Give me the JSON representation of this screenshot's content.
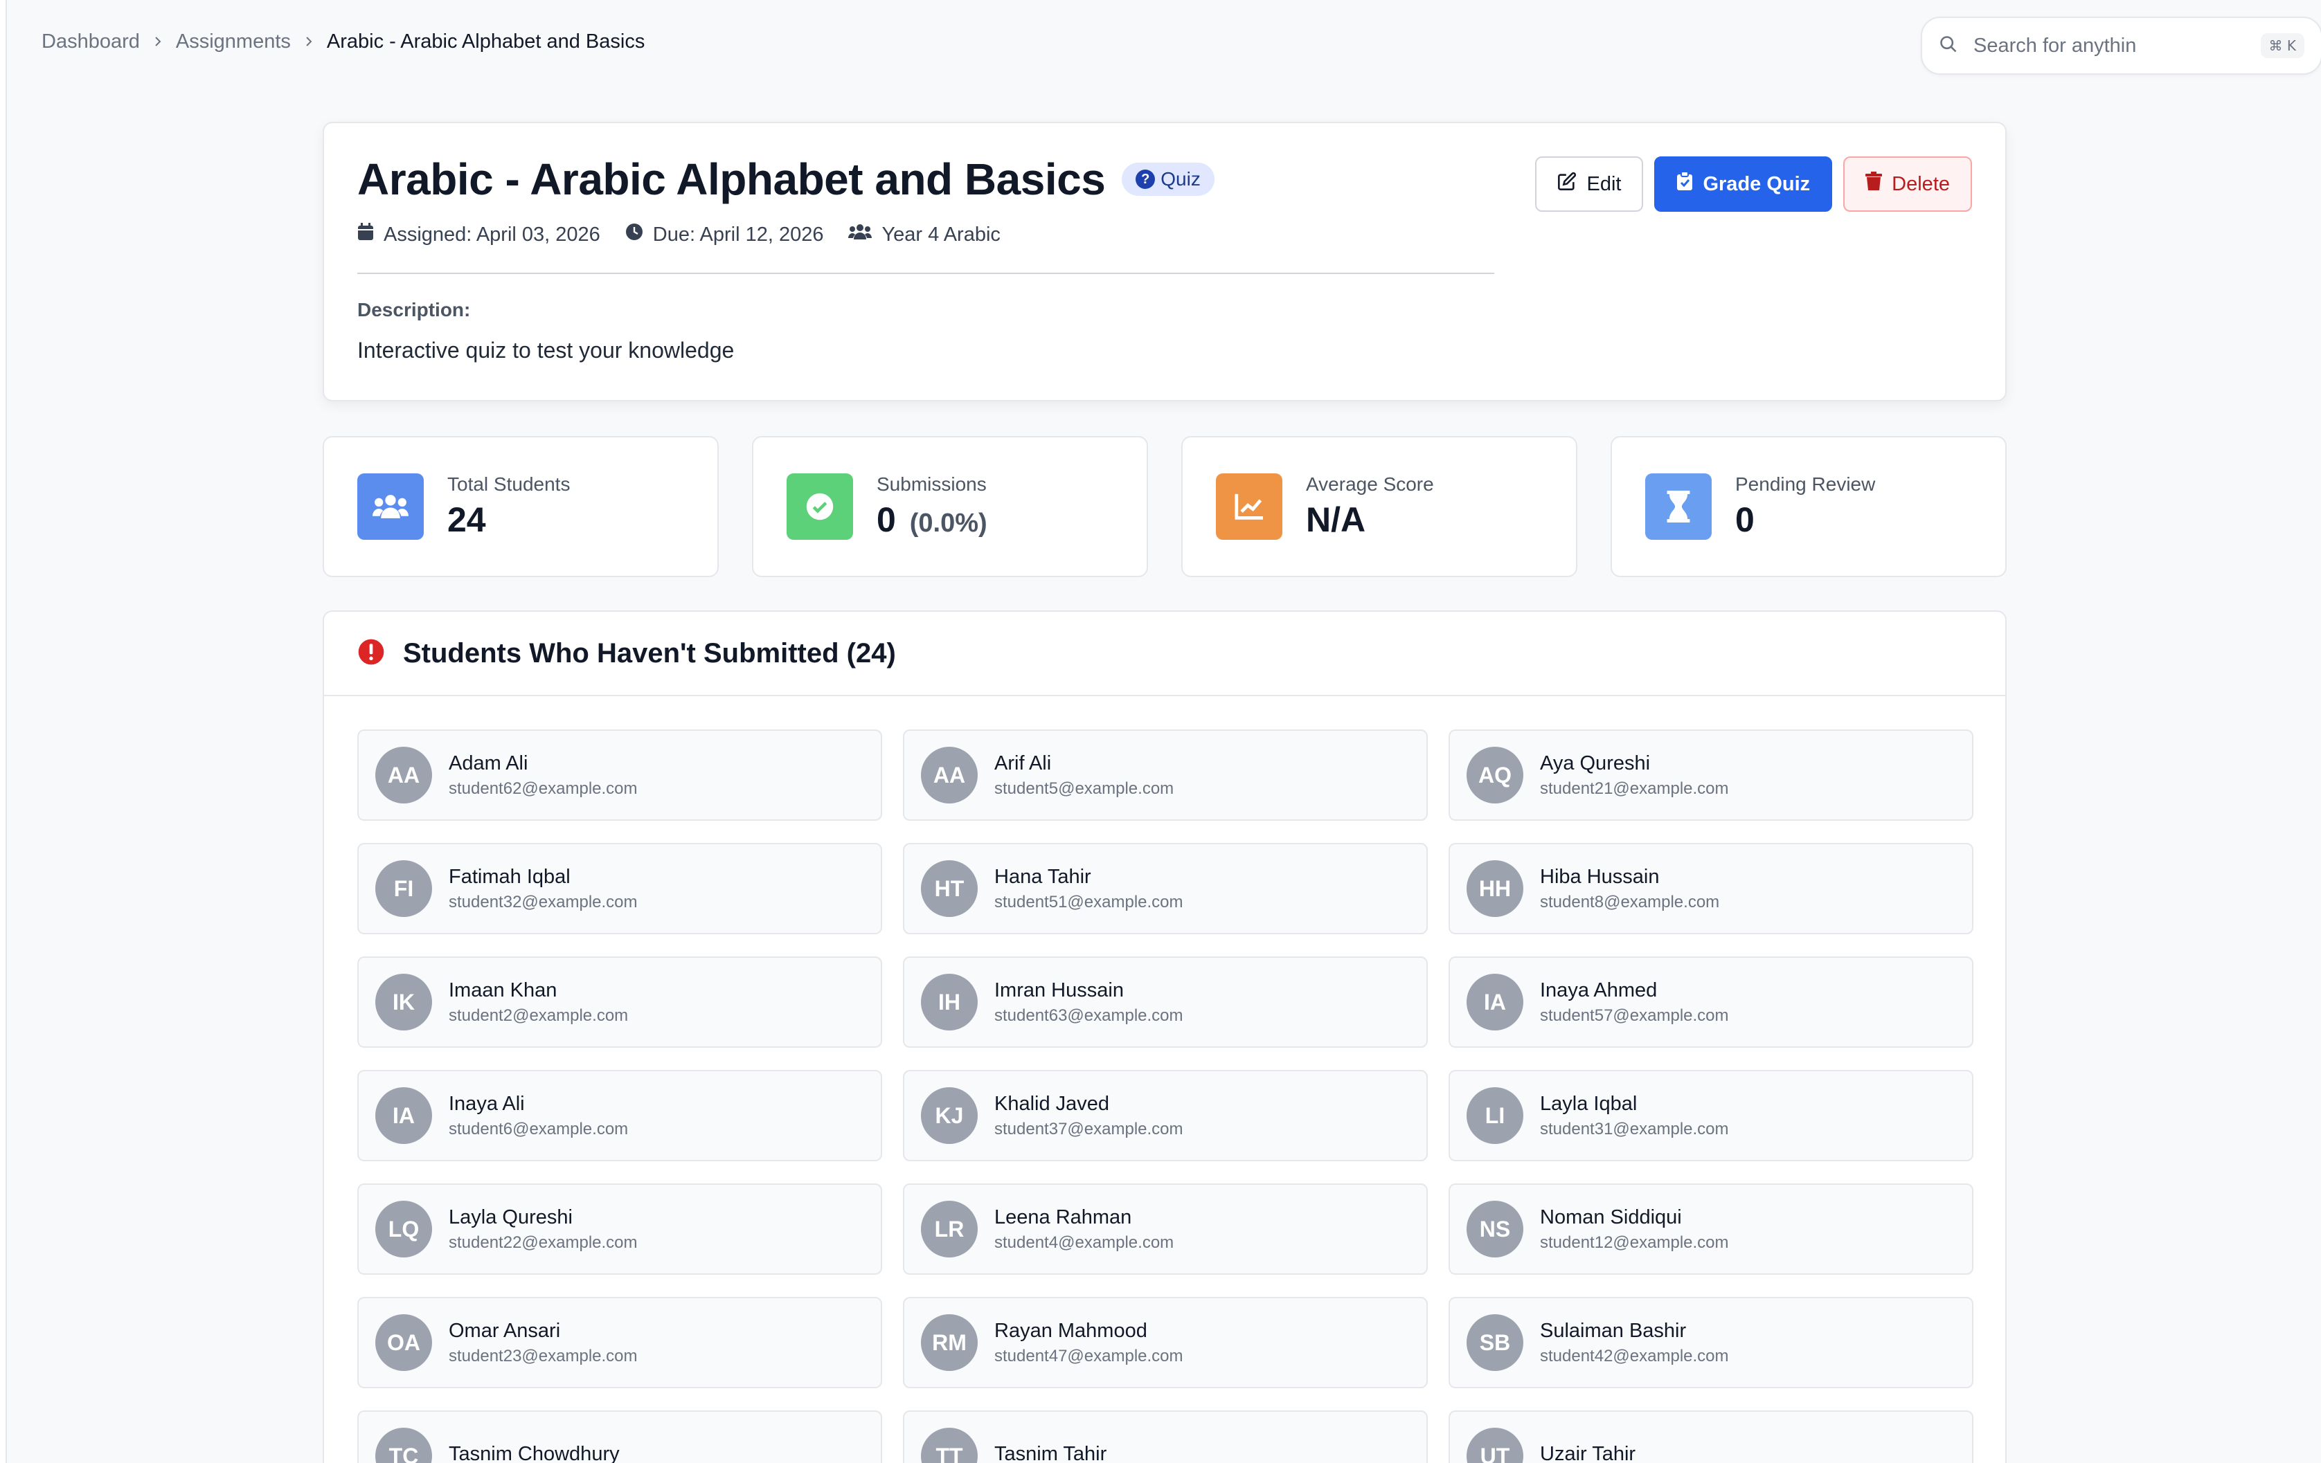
{
  "breadcrumb": {
    "items": [
      "Dashboard",
      "Assignments"
    ],
    "current": "Arabic - Arabic Alphabet and Basics"
  },
  "search": {
    "placeholder": "Search for anythin",
    "shortcut": "⌘ K"
  },
  "assignment": {
    "title": "Arabic - Arabic Alphabet and Basics",
    "type_badge": "Quiz",
    "assigned": "Assigned: April 03, 2026",
    "due": "Due: April 12, 2026",
    "class": "Year 4 Arabic",
    "description_label": "Description:",
    "description": "Interactive quiz to test your knowledge"
  },
  "actions": {
    "edit": "Edit",
    "grade": "Grade Quiz",
    "delete": "Delete"
  },
  "stats": {
    "total_students": {
      "label": "Total Students",
      "value": "24",
      "color": "#5b8def"
    },
    "submissions": {
      "label": "Submissions",
      "value": "0",
      "sub": "(0.0%)",
      "color": "#5dd17a"
    },
    "average_score": {
      "label": "Average Score",
      "value": "N/A",
      "color": "#ef9445"
    },
    "pending_review": {
      "label": "Pending Review",
      "value": "0",
      "color": "#6a9ef0"
    }
  },
  "not_submitted": {
    "title": "Students Who Haven't Submitted (24)",
    "students": [
      {
        "initials": "AA",
        "name": "Adam Ali",
        "email": "student62@example.com"
      },
      {
        "initials": "AA",
        "name": "Arif Ali",
        "email": "student5@example.com"
      },
      {
        "initials": "AQ",
        "name": "Aya Qureshi",
        "email": "student21@example.com"
      },
      {
        "initials": "FI",
        "name": "Fatimah Iqbal",
        "email": "student32@example.com"
      },
      {
        "initials": "HT",
        "name": "Hana Tahir",
        "email": "student51@example.com"
      },
      {
        "initials": "HH",
        "name": "Hiba Hussain",
        "email": "student8@example.com"
      },
      {
        "initials": "IK",
        "name": "Imaan Khan",
        "email": "student2@example.com"
      },
      {
        "initials": "IH",
        "name": "Imran Hussain",
        "email": "student63@example.com"
      },
      {
        "initials": "IA",
        "name": "Inaya Ahmed",
        "email": "student57@example.com"
      },
      {
        "initials": "IA",
        "name": "Inaya Ali",
        "email": "student6@example.com"
      },
      {
        "initials": "KJ",
        "name": "Khalid Javed",
        "email": "student37@example.com"
      },
      {
        "initials": "LI",
        "name": "Layla Iqbal",
        "email": "student31@example.com"
      },
      {
        "initials": "LQ",
        "name": "Layla Qureshi",
        "email": "student22@example.com"
      },
      {
        "initials": "LR",
        "name": "Leena Rahman",
        "email": "student4@example.com"
      },
      {
        "initials": "NS",
        "name": "Noman Siddiqui",
        "email": "student12@example.com"
      },
      {
        "initials": "OA",
        "name": "Omar Ansari",
        "email": "student23@example.com"
      },
      {
        "initials": "RM",
        "name": "Rayan Mahmood",
        "email": "student47@example.com"
      },
      {
        "initials": "SB",
        "name": "Sulaiman Bashir",
        "email": "student42@example.com"
      },
      {
        "initials": "TC",
        "name": "Tasnim Chowdhury",
        "email": ""
      },
      {
        "initials": "TT",
        "name": "Tasnim Tahir",
        "email": ""
      },
      {
        "initials": "UT",
        "name": "Uzair Tahir",
        "email": ""
      }
    ]
  },
  "icons": {
    "chevron": "chevron-right-icon",
    "search": "search-icon",
    "calendar": "calendar-icon",
    "clock": "clock-icon",
    "users": "users-icon",
    "edit": "edit-icon",
    "clipboard": "clipboard-check-icon",
    "trash": "trash-icon",
    "alert": "alert-circle-icon"
  }
}
